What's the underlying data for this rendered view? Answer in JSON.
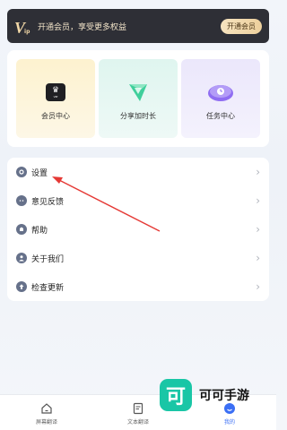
{
  "vip": {
    "text": "开通会员，享受更多权益",
    "button": "开通会员",
    "badge_letters": "V",
    "badge_sub": "ip"
  },
  "features": [
    {
      "label": "会员中心",
      "icon": "crown-icon"
    },
    {
      "label": "分享加时长",
      "icon": "share-flag-icon"
    },
    {
      "label": "任务中心",
      "icon": "task-clock-icon"
    }
  ],
  "menu": [
    {
      "label": "设置",
      "icon": "settings-icon"
    },
    {
      "label": "意见反馈",
      "icon": "feedback-icon"
    },
    {
      "label": "帮助",
      "icon": "help-icon"
    },
    {
      "label": "关于我们",
      "icon": "about-icon"
    },
    {
      "label": "检查更新",
      "icon": "update-icon"
    }
  ],
  "bottom_nav": [
    {
      "label": "屏幕翻译",
      "icon": "home-icon",
      "active": false
    },
    {
      "label": "文本翻译",
      "icon": "document-icon",
      "active": false
    },
    {
      "label": "我的",
      "icon": "profile-icon",
      "active": true
    }
  ],
  "watermark": {
    "logo": "可",
    "text": "可可手游"
  },
  "colors": {
    "accent": "#3b6ff5",
    "vip_dark": "#2e2f36",
    "vip_gold": "#f3d9a8",
    "annotation_red": "#e53935",
    "watermark_teal": "#19c6a6"
  }
}
